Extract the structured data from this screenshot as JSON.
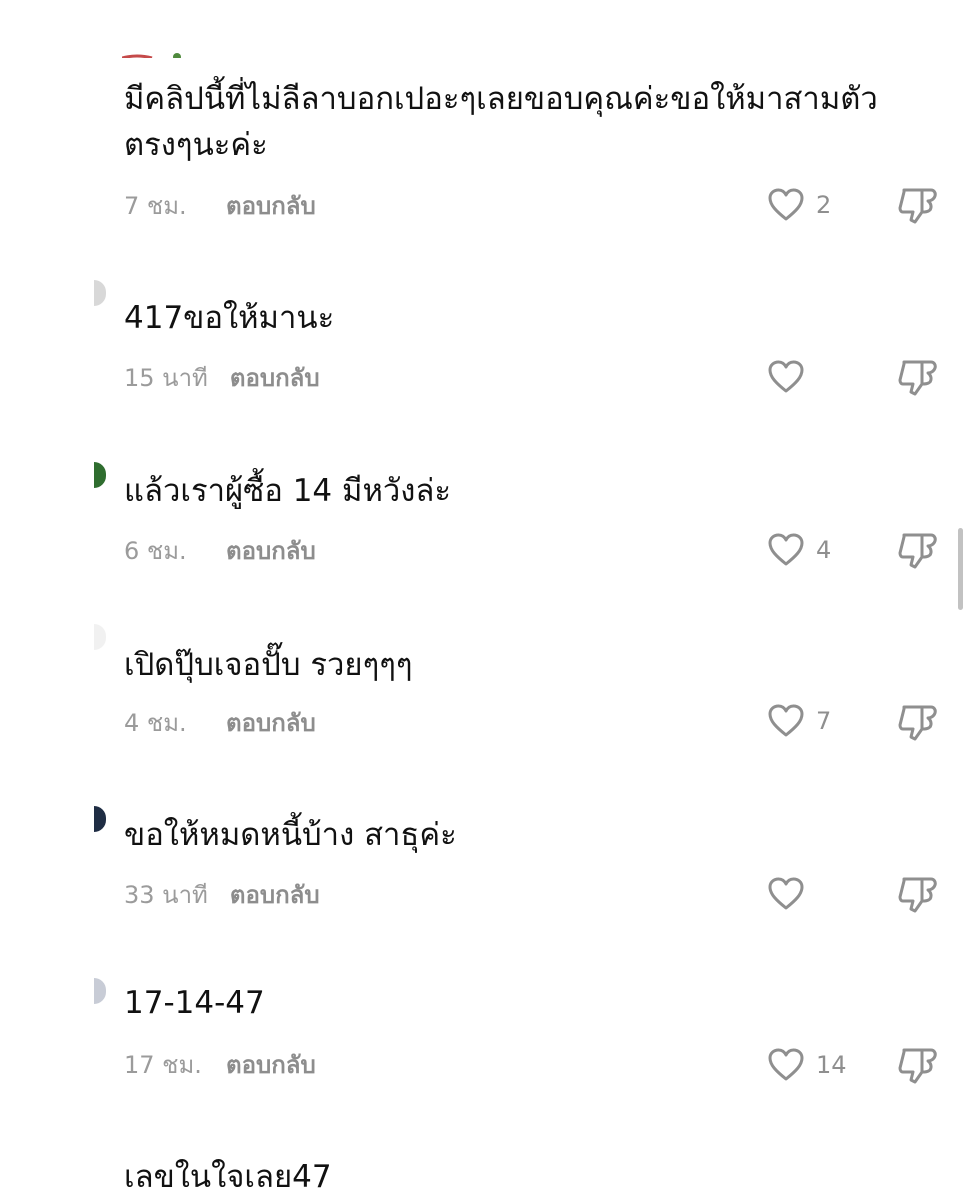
{
  "comments": [
    {
      "text": "มีคลิปนี้ที่ไม่ลีลาบอกเปอะๆเลยขอบคุณค่ะขอให้มาสามตัวตรงๆนะค่ะ",
      "time": "7 ชม.",
      "reply": "ตอบกลับ",
      "likes": "2"
    },
    {
      "text": "417ขอให้มานะ",
      "time": "15 นาที",
      "reply": "ตอบกลับ",
      "likes": ""
    },
    {
      "text": "แล้วเราผู้ซื้อ 14 มีหวังล่ะ",
      "time": "6 ชม.",
      "reply": "ตอบกลับ",
      "likes": "4"
    },
    {
      "text": "เปิดปุ๊บเจอปั๊บ รวยๆๆๆ",
      "time": "4 ชม.",
      "reply": "ตอบกลับ",
      "likes": "7"
    },
    {
      "text": "ขอให้หมดหนี้บ้าง สาธุค่ะ",
      "time": "33 นาที",
      "reply": "ตอบกลับ",
      "likes": ""
    },
    {
      "text": "17-14-47",
      "time": "17 ชม.",
      "reply": "ตอบกลับ",
      "likes": "14"
    },
    {
      "text": "เลขในใจเลย47"
    }
  ],
  "icons": {
    "like": "heart-outline-icon",
    "dislike": "thumbs-down-outline-icon"
  },
  "colors": {
    "text": "#111111",
    "meta": "#9b9b9b",
    "icon": "#8f8f8f",
    "background": "#ffffff"
  }
}
